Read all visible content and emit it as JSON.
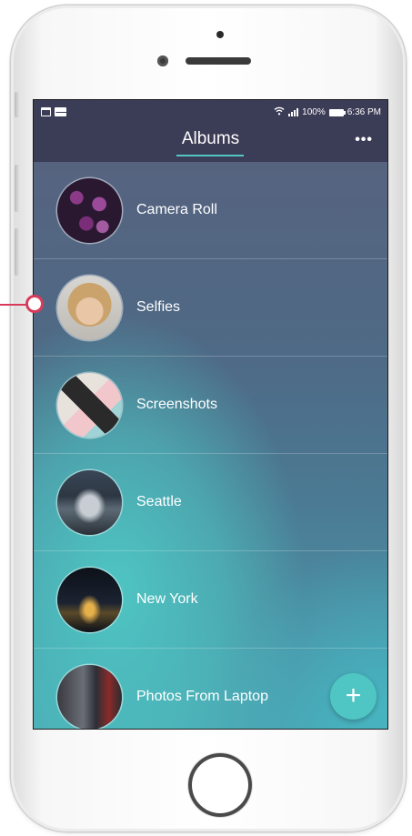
{
  "status_bar": {
    "battery": "100%",
    "time": "6:36 PM",
    "icons": [
      "calendar-icon",
      "mail-icon",
      "wifi-icon",
      "signal-icon",
      "battery-icon"
    ]
  },
  "header": {
    "title": "Albums",
    "menu_icon": "more-icon",
    "menu_glyph": "•••"
  },
  "albums": [
    {
      "label": "Camera Roll"
    },
    {
      "label": "Selfies"
    },
    {
      "label": "Screenshots"
    },
    {
      "label": "Seattle"
    },
    {
      "label": "New York"
    },
    {
      "label": "Photos From Laptop"
    }
  ],
  "fab": {
    "glyph": "+",
    "icon": "add-icon"
  },
  "colors": {
    "accent": "#4fc6c3",
    "header_bg": "#3b3c56",
    "annotation": "#d83b5a"
  }
}
